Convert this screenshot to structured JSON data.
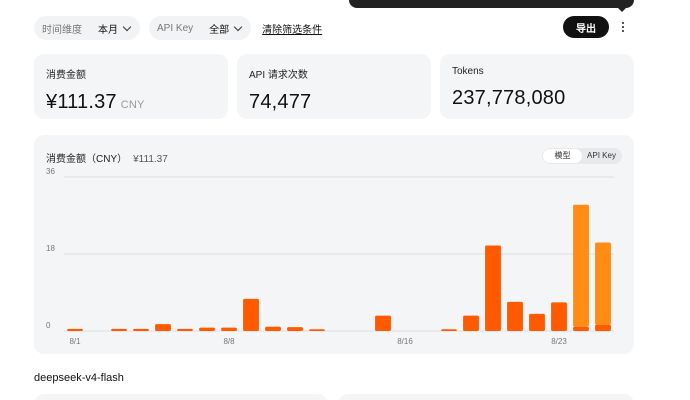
{
  "filters": {
    "time": {
      "label": "时间维度",
      "value": "本月"
    },
    "api_key": {
      "label": "API Key",
      "value": "全部"
    },
    "clear_label": "清除筛选条件"
  },
  "toolbar": {
    "export_label": "导出"
  },
  "metrics": [
    {
      "label": "消费金额",
      "value": "¥111.37",
      "unit": "CNY"
    },
    {
      "label": "API 请求次数",
      "value": "74,477",
      "unit": ""
    },
    {
      "label": "Tokens",
      "value": "237,778,080",
      "unit": ""
    }
  ],
  "chart": {
    "title": "消费金额（CNY）",
    "total": "¥111.37",
    "toggle": {
      "options": [
        "模型",
        "API Key"
      ],
      "active": 0
    }
  },
  "chart_data": {
    "type": "bar",
    "stacked": true,
    "x_tick_labels": [
      "8/1",
      "8/8",
      "8/16",
      "8/23"
    ],
    "x_tick_indices": [
      0,
      7,
      15,
      22
    ],
    "y_ticks": [
      0,
      18,
      36
    ],
    "ylim": [
      0,
      36
    ],
    "grid": true,
    "colors": {
      "primary": "#ff5a00",
      "secondary": "#ff8c14"
    },
    "series": [
      {
        "values": [
          0.5,
          0,
          0.5,
          0.5,
          1.6,
          0.5,
          0.8,
          0.8,
          7.5,
          1.0,
          0.9,
          0.4,
          0,
          0,
          3.6,
          0,
          0,
          0.4,
          3.6,
          20.0,
          6.8,
          4.0,
          6.7,
          1.0,
          1.5
        ]
      },
      {
        "values": [
          0,
          0,
          0,
          0,
          0,
          0,
          0,
          0,
          0,
          0,
          0,
          0,
          0,
          0,
          0,
          0,
          0,
          0,
          0,
          0,
          0,
          0,
          0,
          28.5,
          19.2
        ]
      }
    ]
  },
  "section": {
    "title": "deepseek-v4-flash"
  }
}
